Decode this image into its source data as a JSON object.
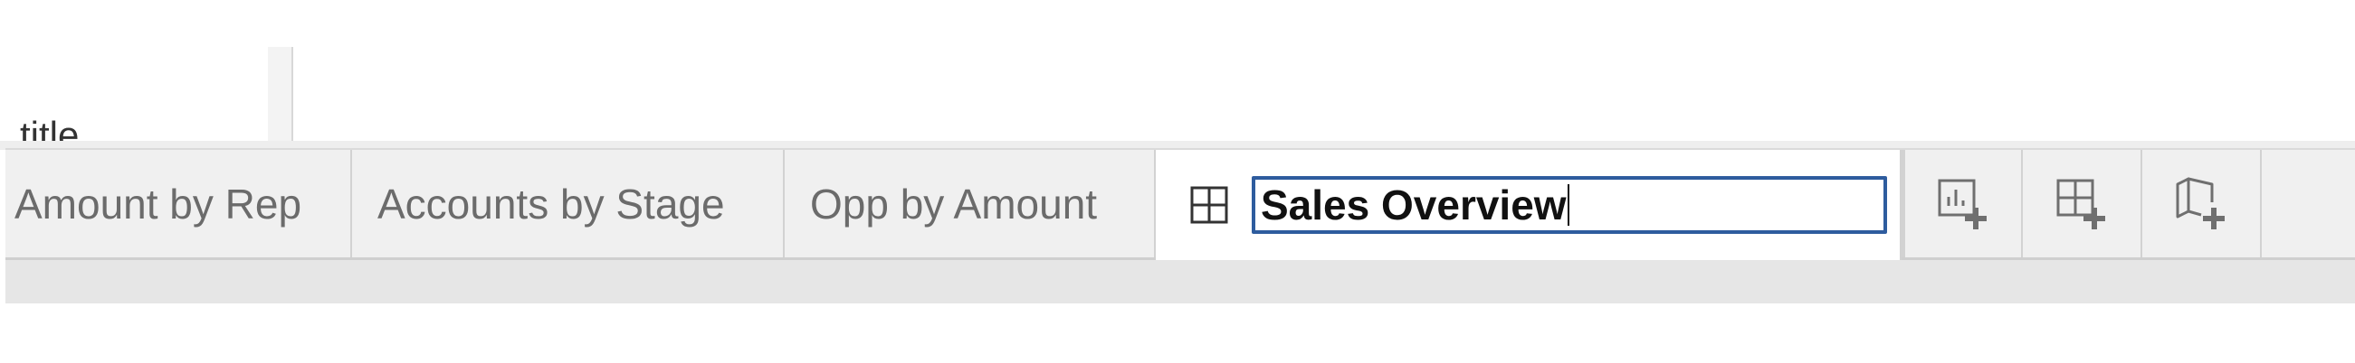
{
  "field_panel": {
    "label": "title"
  },
  "tabs": [
    {
      "label": "Amount by Rep"
    },
    {
      "label": "Accounts by Stage"
    },
    {
      "label": "Opp by Amount"
    }
  ],
  "active_tab": {
    "icon": "dashboard-grid-icon",
    "rename_value": "Sales Overview"
  },
  "add_buttons": [
    {
      "icon": "new-worksheet-icon"
    },
    {
      "icon": "new-dashboard-icon"
    },
    {
      "icon": "new-story-icon"
    }
  ],
  "colors": {
    "focus_border": "#2e5c9e",
    "tab_bar_bg": "#f0f0f0",
    "tab_text": "#6b6b6b",
    "icon_gray": "#6f6f6f"
  }
}
